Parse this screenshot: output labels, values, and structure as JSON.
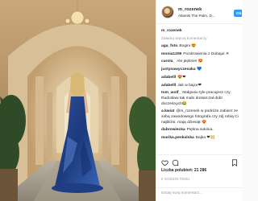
{
  "post": {
    "username": "m_rozenek",
    "location": "Atlantis The Palm, D...",
    "follow_label": "Ob",
    "caption_user": "m_rozenek",
    "view_more": "Załaduj więcej komentarzy"
  },
  "comments": [
    {
      "user": "aga_foto",
      "text": "Bogini 😍"
    },
    {
      "user": "monia1209",
      "text": "Pozdrowienia z Dubajul ☀"
    },
    {
      "user": "carola_",
      "text": "Ale pięknie! 😍"
    },
    {
      "user": "justynawyczesaka",
      "text": "💙"
    },
    {
      "user": "adabelll",
      "text": "😍❤"
    },
    {
      "user": "adabelll",
      "text": "Jak w bajce❤"
    },
    {
      "user": "tom_wolf_",
      "text": "Małgosiu tyle pracujesz czy Radosław tak mało dostarczał dobr docześnych😂"
    },
    {
      "user": "a.kwiat",
      "text": "@m_rozenek w podróże zabierz ze sobą zawodowego fotografa czy zdj robią Ci najbliżsi. mają dziesiąt 😍"
    },
    {
      "user": "dabrowiecka",
      "text": "Piękna sukinia.."
    },
    {
      "user": "marika.penkalska",
      "text": "Bajka ❤💥"
    }
  ],
  "stats": {
    "likes_label": "Liczba polubień:",
    "likes_count": "21 286",
    "date": "5 GODZIN TEMU"
  },
  "input": {
    "placeholder": "Dodaj swój komentarz..."
  },
  "colors": {
    "accent": "#3897f0",
    "muted": "#999999"
  },
  "icons": [
    "heart-icon",
    "comment-icon",
    "bookmark-icon"
  ]
}
